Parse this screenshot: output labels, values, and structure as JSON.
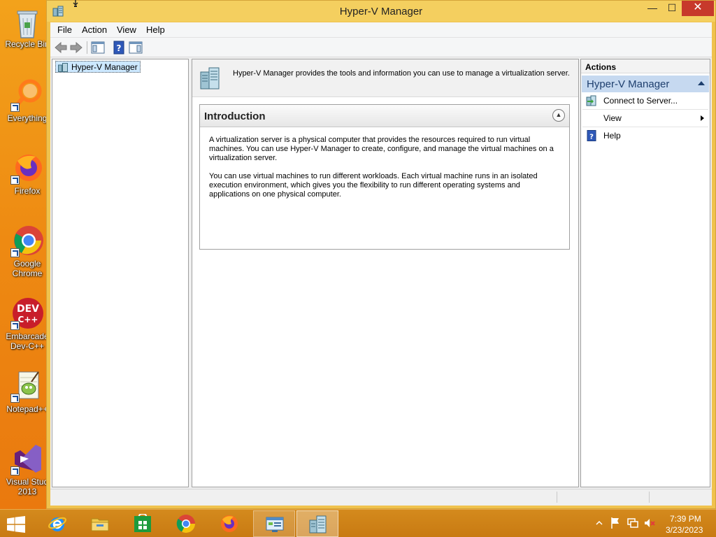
{
  "desktop": {
    "icons": [
      {
        "label": "Recycle Bin",
        "icon": "recycle-bin-icon"
      },
      {
        "label": "Everything",
        "icon": "everything-search-icon"
      },
      {
        "label": "Firefox",
        "icon": "firefox-icon"
      },
      {
        "label": "Google\nChrome",
        "icon": "chrome-icon"
      },
      {
        "label": "Embarcade\nDev-C++",
        "icon": "devcpp-icon"
      },
      {
        "label": "Notepad++",
        "icon": "notepadpp-icon"
      },
      {
        "label": "Visual Stud\n2013",
        "icon": "visual-studio-icon"
      }
    ]
  },
  "window": {
    "title": "Hyper-V Manager",
    "controls": {
      "minimize": "—",
      "maximize": "☐",
      "close": "✕"
    },
    "menu": [
      "File",
      "Action",
      "View",
      "Help"
    ],
    "toolbar": [
      {
        "icon": "back-arrow-icon"
      },
      {
        "icon": "forward-arrow-icon"
      },
      {
        "icon": "show-hide-console-tree-icon"
      },
      {
        "icon": "help-icon"
      },
      {
        "icon": "show-hide-action-pane-icon"
      }
    ],
    "tree": {
      "root_label": "Hyper-V Manager"
    },
    "center": {
      "header_text": "Hyper-V Manager provides the tools and information you can use to manage a virtualization server.",
      "intro_title": "Introduction",
      "intro_paragraph_1": "A virtualization server is a physical computer that provides the resources required to run virtual machines. You can use Hyper-V Manager to create, configure, and manage the virtual machines on a virtualization server.",
      "intro_paragraph_2": "You can use virtual machines to run different workloads. Each virtual machine runs in an isolated execution environment, which gives you the flexibility to run different operating systems and applications on one physical computer."
    },
    "actions": {
      "header": "Actions",
      "group_title": "Hyper-V Manager",
      "items": [
        {
          "label": "Connect to Server...",
          "icon": "connect-server-icon",
          "submenu": false
        },
        {
          "label": "View",
          "icon": "",
          "submenu": true
        },
        {
          "label": "Help",
          "icon": "help-icon",
          "submenu": false
        }
      ]
    }
  },
  "taskbar": {
    "apps": [
      {
        "name": "Internet Explorer",
        "icon": "internet-explorer-icon",
        "state": "pinned"
      },
      {
        "name": "File Explorer",
        "icon": "file-explorer-icon",
        "state": "pinned"
      },
      {
        "name": "Store",
        "icon": "store-icon",
        "state": "pinned"
      },
      {
        "name": "Google Chrome",
        "icon": "chrome-icon",
        "state": "pinned"
      },
      {
        "name": "Firefox",
        "icon": "firefox-icon",
        "state": "pinned"
      },
      {
        "name": "Control Panel",
        "icon": "control-panel-icon",
        "state": "running"
      },
      {
        "name": "Hyper-V Manager",
        "icon": "hyperv-manager-icon",
        "state": "active"
      }
    ],
    "tray": {
      "time": "7:39 PM",
      "date": "3/23/2023"
    }
  },
  "colors": {
    "desktop_background": "#ee8a12",
    "window_frame": "#f4cf5f",
    "close_button": "#c7392b",
    "actions_group_bg": "#c6d9f0",
    "selection_bg": "#cce8ff"
  }
}
